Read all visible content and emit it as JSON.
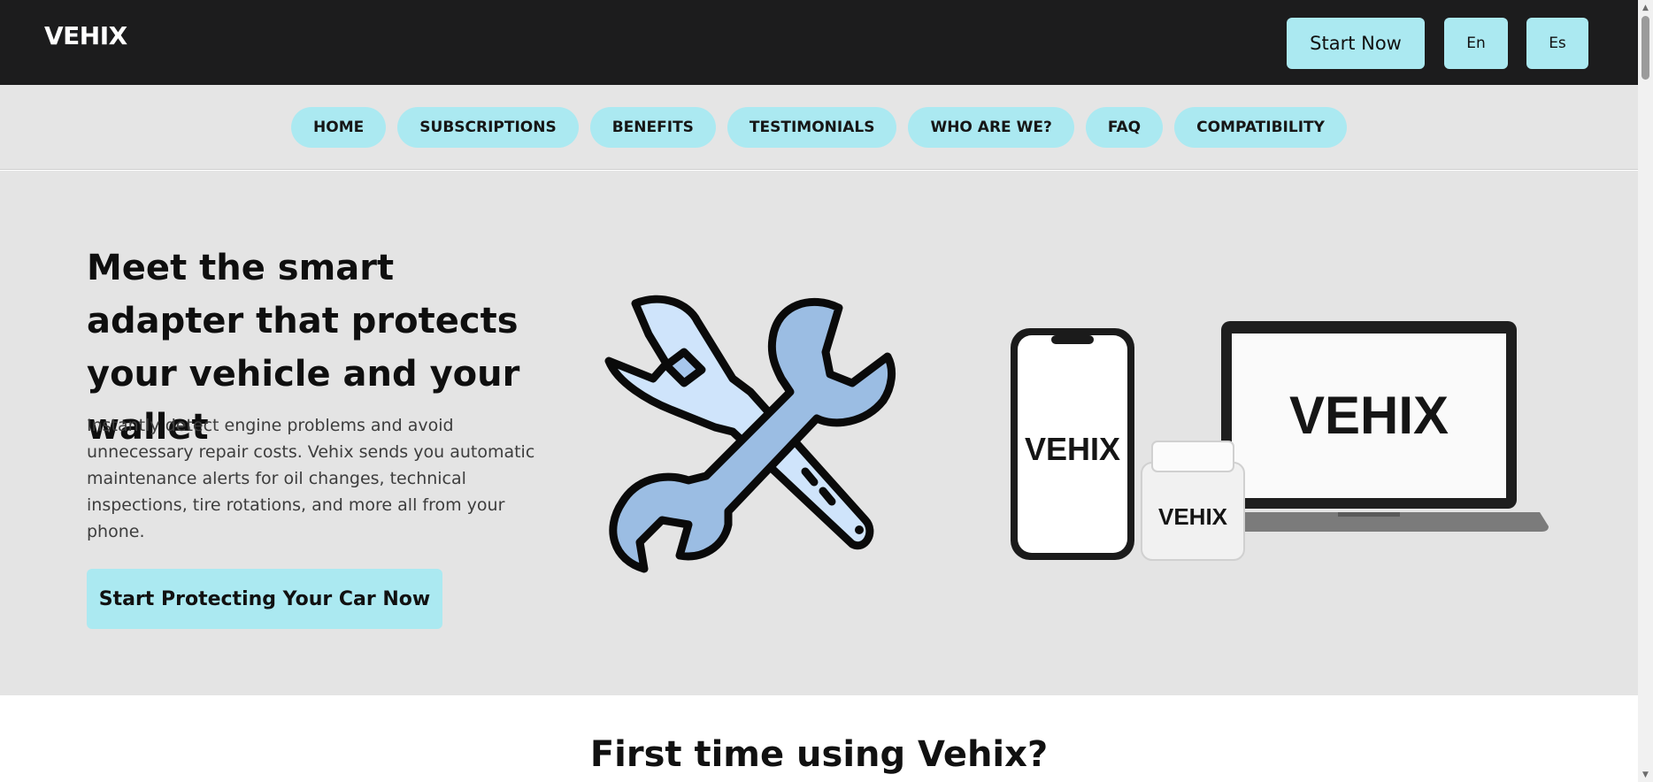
{
  "header": {
    "brand": "VEHIX",
    "start_now_label": "Start Now",
    "lang_en_label": "En",
    "lang_es_label": "Es"
  },
  "nav": {
    "items": [
      {
        "label": "HOME"
      },
      {
        "label": "SUBSCRIPTIONS"
      },
      {
        "label": "BENEFITS"
      },
      {
        "label": "TESTIMONIALS"
      },
      {
        "label": "WHO ARE WE?"
      },
      {
        "label": "FAQ"
      },
      {
        "label": "COMPATIBILITY"
      }
    ]
  },
  "hero": {
    "title": "Meet the smart adapter that protects your vehicle and your wallet",
    "description": "Instantly detect engine problems and avoid unnecessary repair costs. Vehix sends you automatic maintenance alerts for oil changes, technical inspections, tire rotations, and more all from your phone.",
    "cta_label": "Start Protecting Your Car Now",
    "devices": {
      "phone_brand": "VEHIX",
      "laptop_brand": "VEHIX",
      "adapter_brand": "VEHIX"
    }
  },
  "section": {
    "title": "First time using Vehix?"
  },
  "colors": {
    "header_bg": "#1c1c1d",
    "accent": "#abe9f1",
    "hero_bg": "#e4e4e4"
  },
  "icons": {
    "tools": "wrench-crossed-icon",
    "scroll_up": "scroll-up-arrow-icon",
    "scroll_down": "scroll-down-arrow-icon"
  }
}
